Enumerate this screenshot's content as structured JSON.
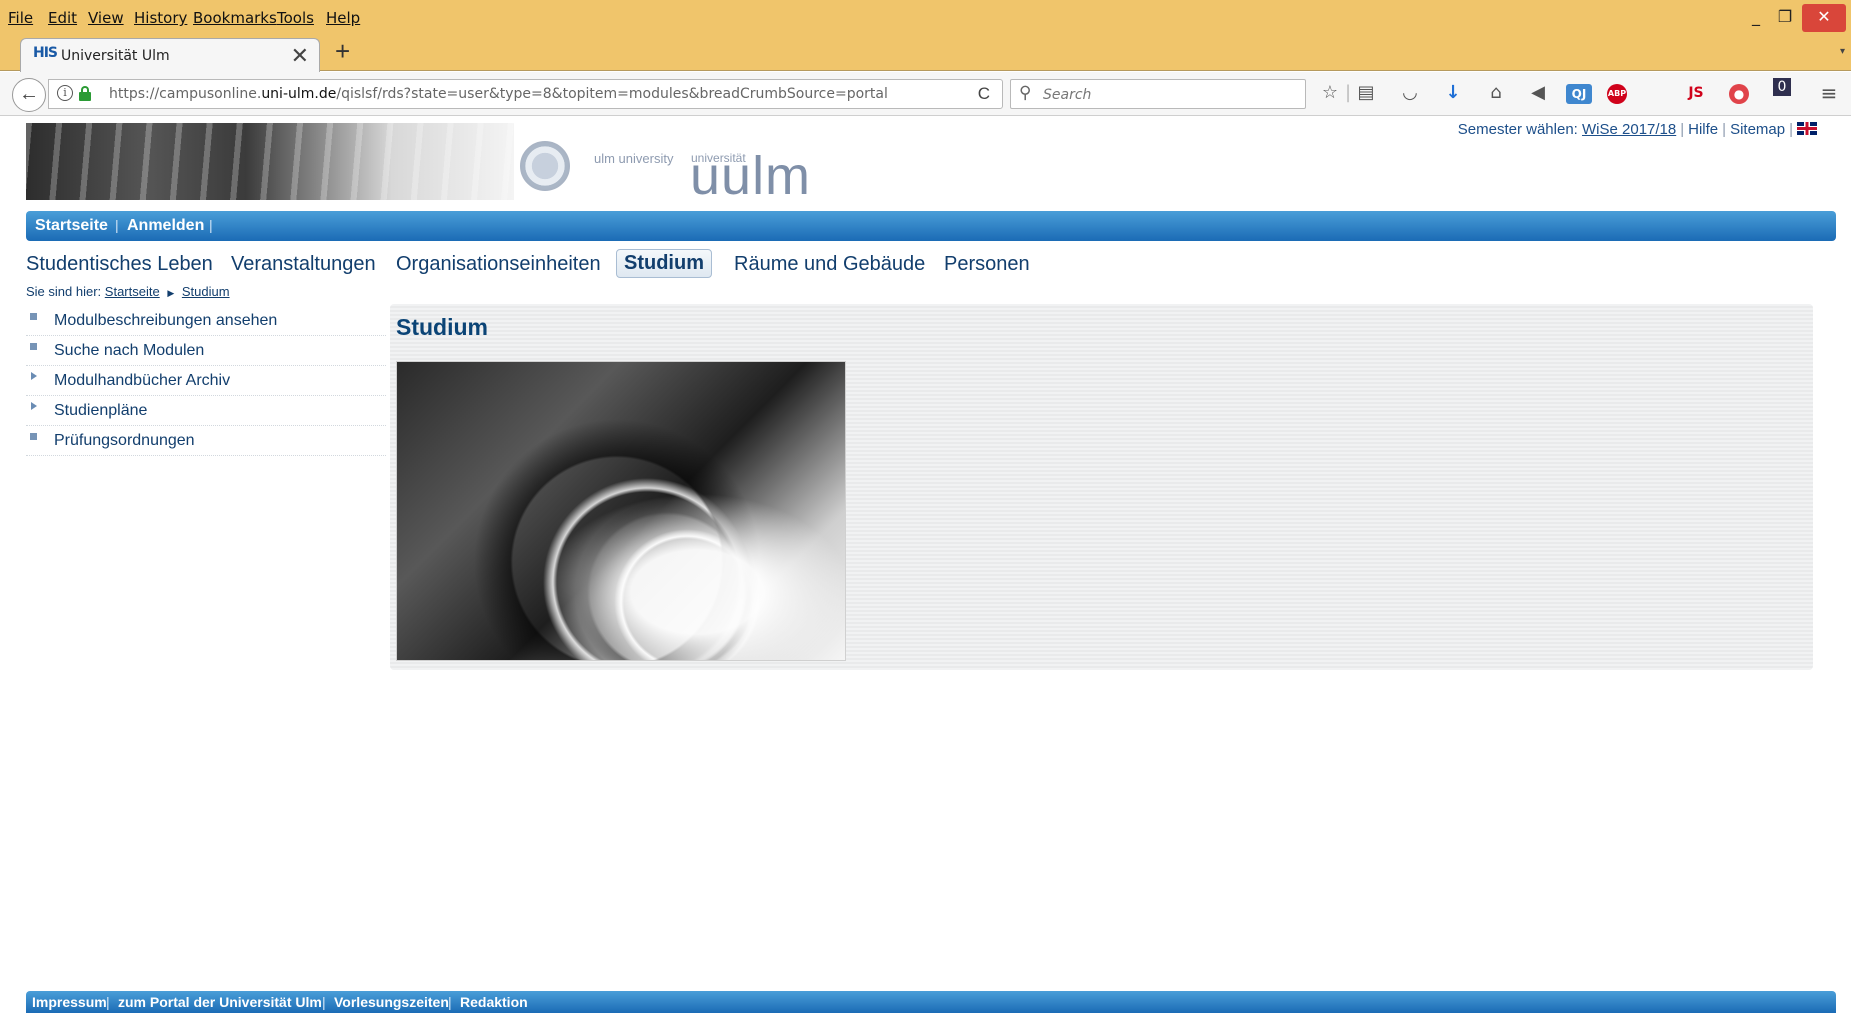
{
  "menubar": {
    "items": [
      "File",
      "Edit",
      "View",
      "History",
      "Bookmarks",
      "Tools",
      "Help"
    ],
    "window_controls": {
      "minimize": "_",
      "maximize": "❐",
      "close": "✕"
    }
  },
  "tab": {
    "favicon_text": "HIS",
    "title": "Universität Ulm",
    "close": "✕",
    "new_tab": "+",
    "overflow": "▾"
  },
  "navbar": {
    "back": "←",
    "url_prefix": "https://campusonline.",
    "url_domain": "uni-ulm.de",
    "url_path": "/qislsf/rds?state=user&type=8&topitem=modules&breadCrumbSource=portal",
    "reload": "C",
    "search_placeholder": "Search",
    "toolbar_icons": [
      "star-icon",
      "reading-list-icon",
      "pocket-icon",
      "download-icon",
      "home-icon",
      "send-icon",
      "qj-extension-icon",
      "adblock-icon",
      "js-toggle-icon",
      "noscript-icon",
      "notification-icon",
      "hamburger-menu-icon"
    ],
    "qj_label": "QJ",
    "abp_label": "ABP",
    "js_label": "JS",
    "badge_count": "0"
  },
  "header": {
    "ulm_university": "ulm university",
    "universitaet": "universität",
    "uulm": "uulm",
    "semester_label": "Semester wählen:",
    "semester_value": "WiSe 2017/18",
    "help": "Hilfe",
    "sitemap": "Sitemap"
  },
  "bluebar": {
    "home": "Startseite",
    "login": "Anmelden"
  },
  "mainnav": {
    "items": [
      "Studentisches Leben",
      "Veranstaltungen",
      "Organisationseinheiten",
      "Studium",
      "Räume und Gebäude",
      "Personen"
    ],
    "active": "Studium"
  },
  "breadcrumb": {
    "prefix": "Sie sind hier:",
    "home": "Startseite",
    "current": "Studium"
  },
  "sidemenu": {
    "items": [
      {
        "label": "Modulbeschreibungen ansehen",
        "marker": "bullet"
      },
      {
        "label": "Suche nach Modulen",
        "marker": "bullet"
      },
      {
        "label": "Modulhandbücher Archiv",
        "marker": "arrow"
      },
      {
        "label": "Studienpläne",
        "marker": "arrow"
      },
      {
        "label": "Prüfungsordnungen",
        "marker": "bullet"
      }
    ]
  },
  "content": {
    "title": "Studium"
  },
  "footer": {
    "links": [
      "Impressum",
      "zum Portal der Universität Ulm",
      "Vorlesungszeiten",
      "Redaktion"
    ]
  },
  "colors": {
    "menubar": "#f0c56b",
    "blue_bar": "#1b6bb5",
    "link": "#123e6d",
    "heading": "#0b4476"
  }
}
